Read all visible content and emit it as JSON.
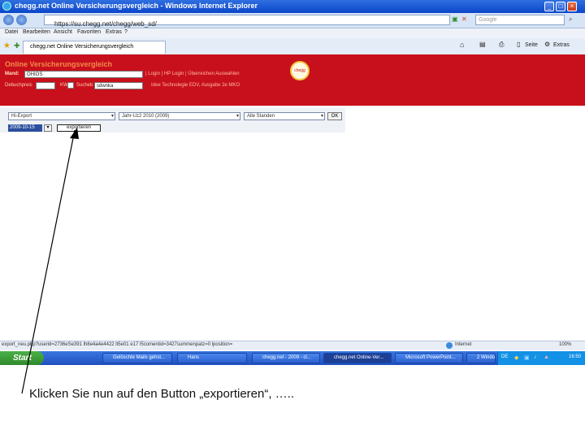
{
  "window": {
    "title": "chegg.net Online Versicherungsvergleich - Windows Internet Explorer"
  },
  "address": {
    "url": "https://su.chegg.net/chegg/web_sd/",
    "search_placeholder": "Google"
  },
  "menu": [
    "Datei",
    "Bearbeiten",
    "Ansicht",
    "Favoriten",
    "Extras",
    "?"
  ],
  "tab": {
    "label": "chegg.net Online Versicherungsvergleich"
  },
  "commandbar": {
    "page_label": "Seite",
    "tools_label": "Extras"
  },
  "page": {
    "brand": "Online Versicherungsvergleich",
    "mandant_label": "Mand:",
    "mandant_value": "OHIOS",
    "header_links": "| Login | HP Login | Überreichen  Auswahlen",
    "gebuehr_label": "Debuchpreis",
    "kw_label": "KW:",
    "lastname_label": "Sucheb",
    "lastname_value": "sdwnka",
    "footer_links": "Idee Technolegie EDV, Ausgabe 2e MKO",
    "logo_text": "chegg",
    "export_select": "Hi-Export",
    "period_select": "Jahr-Uz2 2010 (2009)",
    "sites_select": "Alle Standen",
    "ok_label": "OK",
    "date_value": "2009-10-15",
    "export_button": "exportieren"
  },
  "status": {
    "url": "export_neu.php?userid=2736eSe391 lh8e4a4e4422 lt5e01 e17 l5comentid=3427summenpatz=0 lposition=",
    "zone": "Internet",
    "zoom": "100%"
  },
  "taskbar": {
    "start": "Start",
    "items": [
      "Gelöschte Mails gehst...",
      "Hans",
      "chegg.net - 2009 - cl...",
      "chegg.net Online-Ver...",
      "Microsoft PowerPoint...",
      "2 Windows..."
    ],
    "tray_lang": "DE",
    "clock": "16:50"
  },
  "caption": "Klicken Sie nun auf den Button „exportieren“, …..",
  "colors": {
    "brand_red": "#c8101c",
    "xp_blue": "#1f4fbf",
    "start_green": "#2f8a2c"
  }
}
